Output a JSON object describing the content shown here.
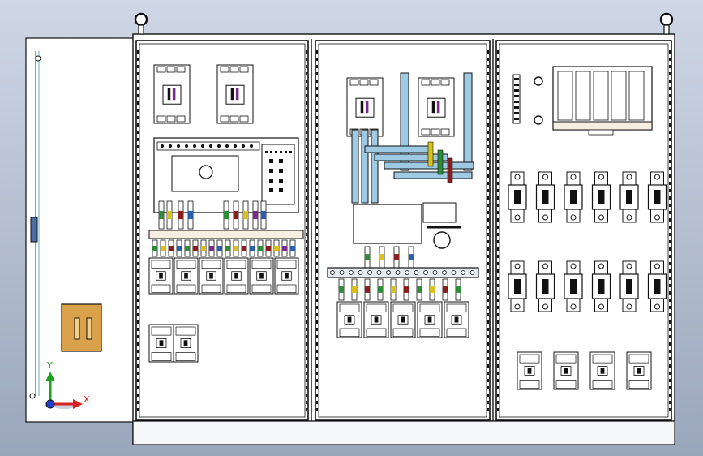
{
  "viewport": {
    "background_top": "#cfd7e6",
    "background_bottom": "#9aa6bb"
  },
  "colors": {
    "line": "#111111",
    "panel_white": "#ffffff",
    "bus_blue": "#9ecbe3",
    "bus_outline": "#2a2a2a",
    "busbar_plate": "#e8ecf2",
    "wood_box": "#d9a24a",
    "wood_edge": "#8a5a18",
    "terminal_block": "#f4efe0",
    "wire_green": "#2e8b3a",
    "wire_red": "#8b1c1c",
    "wire_yellow": "#d8c11c",
    "wire_blue": "#2a5fb0",
    "wire_purple": "#7b2a8c",
    "axis_x": "#d82020",
    "axis_y": "#1aa31a",
    "axis_origin": "#1c3fd0"
  },
  "axis_triad": {
    "x_label": "X",
    "y_label": "Y"
  }
}
